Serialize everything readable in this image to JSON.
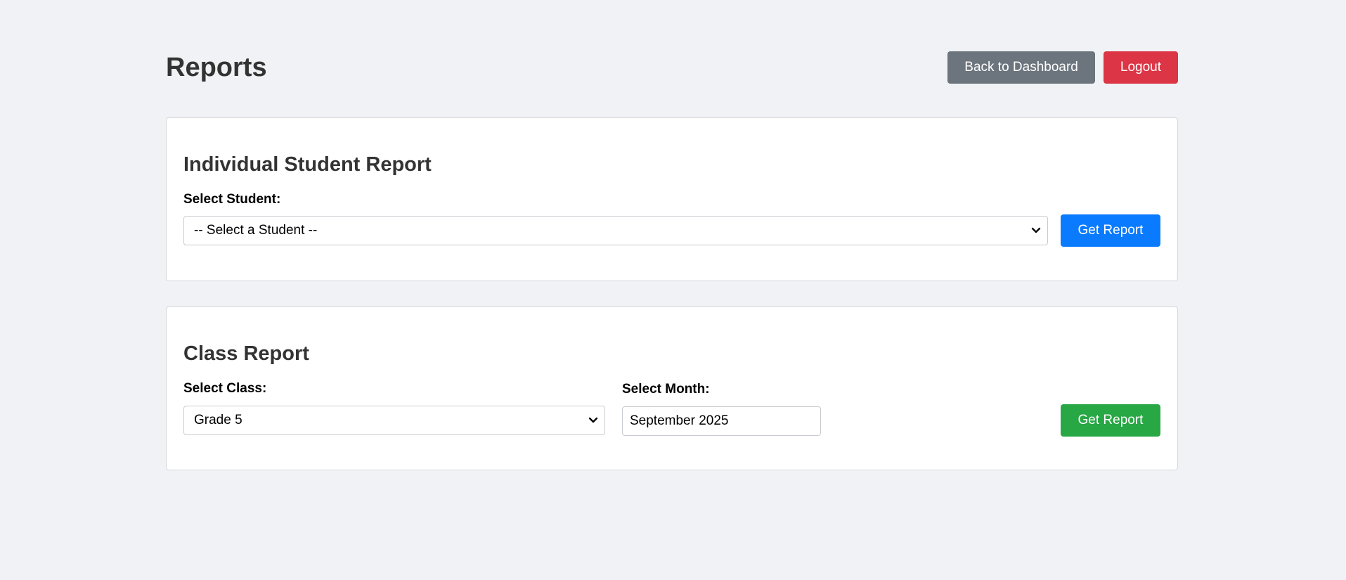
{
  "header": {
    "title": "Reports",
    "back_label": "Back to Dashboard",
    "logout_label": "Logout"
  },
  "student_report": {
    "title": "Individual Student Report",
    "select_label": "Select Student:",
    "select_value": "-- Select a Student --",
    "button_label": "Get Report"
  },
  "class_report": {
    "title": "Class Report",
    "class_label": "Select Class:",
    "class_value": "Grade 5",
    "month_label": "Select Month:",
    "month_value": "September 2025",
    "button_label": "Get Report"
  },
  "colors": {
    "background": "#f0f2f5",
    "back_button": "#6c757d",
    "logout_button": "#dc3545",
    "student_get_report": "#0a7bff",
    "class_get_report": "#28a745"
  },
  "icons": {
    "select_arrow": "chevron-down-icon"
  }
}
